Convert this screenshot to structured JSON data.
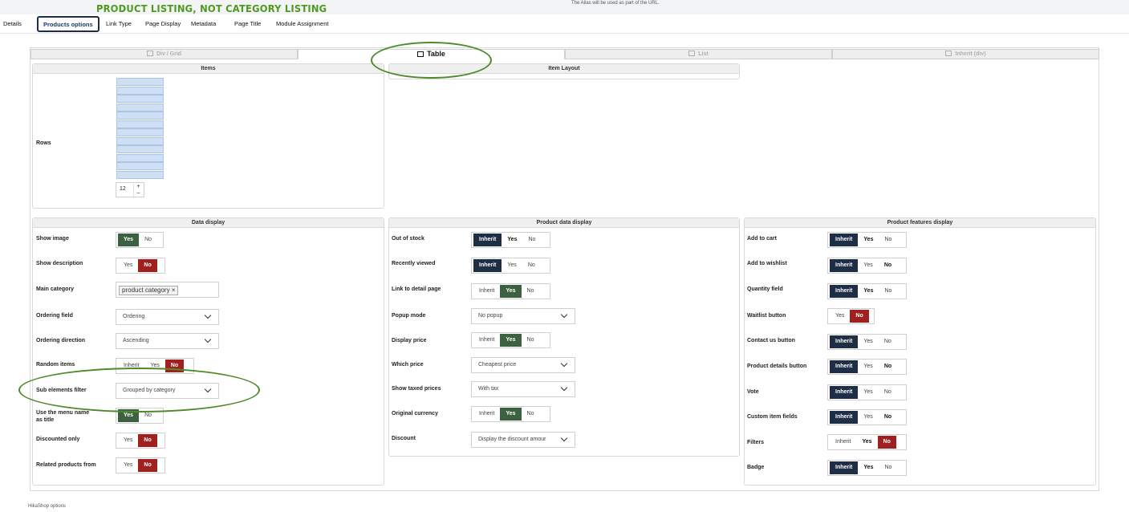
{
  "header": {
    "alias_note": "The Alias will be used as part of the URL.",
    "annotation_title": "PRODUCT LISTING, NOT CATEGORY LISTING"
  },
  "top_tabs": [
    "Details",
    "Products options",
    "Link Type",
    "Page Display",
    "Metadata",
    "Page Title",
    "Module Assignment"
  ],
  "layout_tabs": [
    "Div / Grid",
    "Table",
    "List",
    "Inherit (div)"
  ],
  "items_panel": {
    "title": "Items",
    "rows_label": "Rows",
    "rows_value": "12",
    "plus": "+",
    "minus": "–"
  },
  "item_layout_panel": {
    "title": "Item Layout"
  },
  "data_display": {
    "title": "Data display",
    "show_image": {
      "label": "Show image",
      "yes": "Yes",
      "no": "No"
    },
    "show_description": {
      "label": "Show description",
      "yes": "Yes",
      "no": "No"
    },
    "main_category": {
      "label": "Main category",
      "tag": "product category ×"
    },
    "ordering_field": {
      "label": "Ordering field",
      "value": "Ordering"
    },
    "ordering_direction": {
      "label": "Ordering direction",
      "value": "Ascending"
    },
    "random_items": {
      "label": "Random items",
      "inherit": "Inherit",
      "yes": "Yes",
      "no": "No"
    },
    "sub_elements_filter": {
      "label": "Sub elements filter",
      "value": "Grouped by category"
    },
    "use_menu_name": {
      "label": "Use the menu name as title",
      "yes": "Yes",
      "no": "No"
    },
    "discounted_only": {
      "label": "Discounted only",
      "yes": "Yes",
      "no": "No"
    },
    "related_products": {
      "label": "Related products from",
      "yes": "Yes",
      "no": "No"
    }
  },
  "product_data_display": {
    "title": "Product data display",
    "out_of_stock": {
      "label": "Out of stock",
      "inherit": "Inherit",
      "yes": "Yes",
      "no": "No"
    },
    "recently_viewed": {
      "label": "Recently viewed",
      "inherit": "Inherit",
      "yes": "Yes",
      "no": "No"
    },
    "link_to_detail": {
      "label": "Link to detail page",
      "inherit": "Inherit",
      "yes": "Yes",
      "no": "No"
    },
    "popup_mode": {
      "label": "Popup mode",
      "value": "No popup"
    },
    "display_price": {
      "label": "Display price",
      "inherit": "Inherit",
      "yes": "Yes",
      "no": "No"
    },
    "which_price": {
      "label": "Which price",
      "value": "Cheapest price"
    },
    "show_taxed_prices": {
      "label": "Show taxed prices",
      "value": "With tax"
    },
    "original_currency": {
      "label": "Original currency",
      "inherit": "Inherit",
      "yes": "Yes",
      "no": "No"
    },
    "discount": {
      "label": "Discount",
      "value": "Display the discount amour"
    }
  },
  "product_features_display": {
    "title": "Product features display",
    "add_to_cart": {
      "label": "Add to cart",
      "inherit": "Inherit",
      "yes": "Yes",
      "no": "No"
    },
    "add_to_wishlist": {
      "label": "Add to wishlist",
      "inherit": "Inherit",
      "yes": "Yes",
      "no": "No"
    },
    "quantity_field": {
      "label": "Quantity field",
      "inherit": "Inherit",
      "yes": "Yes",
      "no": "No"
    },
    "waitlist_button": {
      "label": "Waitlist button",
      "yes": "Yes",
      "no": "No"
    },
    "contact_us_button": {
      "label": "Contact us button",
      "inherit": "Inherit",
      "yes": "Yes",
      "no": "No"
    },
    "product_details_button": {
      "label": "Product details button",
      "inherit": "Inherit",
      "yes": "Yes",
      "no": "No"
    },
    "vote": {
      "label": "Vote",
      "inherit": "Inherit",
      "yes": "Yes",
      "no": "No"
    },
    "custom_item_fields": {
      "label": "Custom item fields",
      "inherit": "Inherit",
      "yes": "Yes",
      "no": "No"
    },
    "filters": {
      "label": "Filters",
      "inherit": "Inherit",
      "yes": "Yes",
      "no": "No"
    },
    "badge": {
      "label": "Badge",
      "inherit": "Inherit",
      "yes": "Yes",
      "no": "No"
    }
  },
  "footer": {
    "note": "HikaShop options"
  },
  "colors": {
    "green": "#3c6141",
    "red": "#a01f1f",
    "navy": "#1f2e47",
    "annotation": "#4f8a2a"
  }
}
